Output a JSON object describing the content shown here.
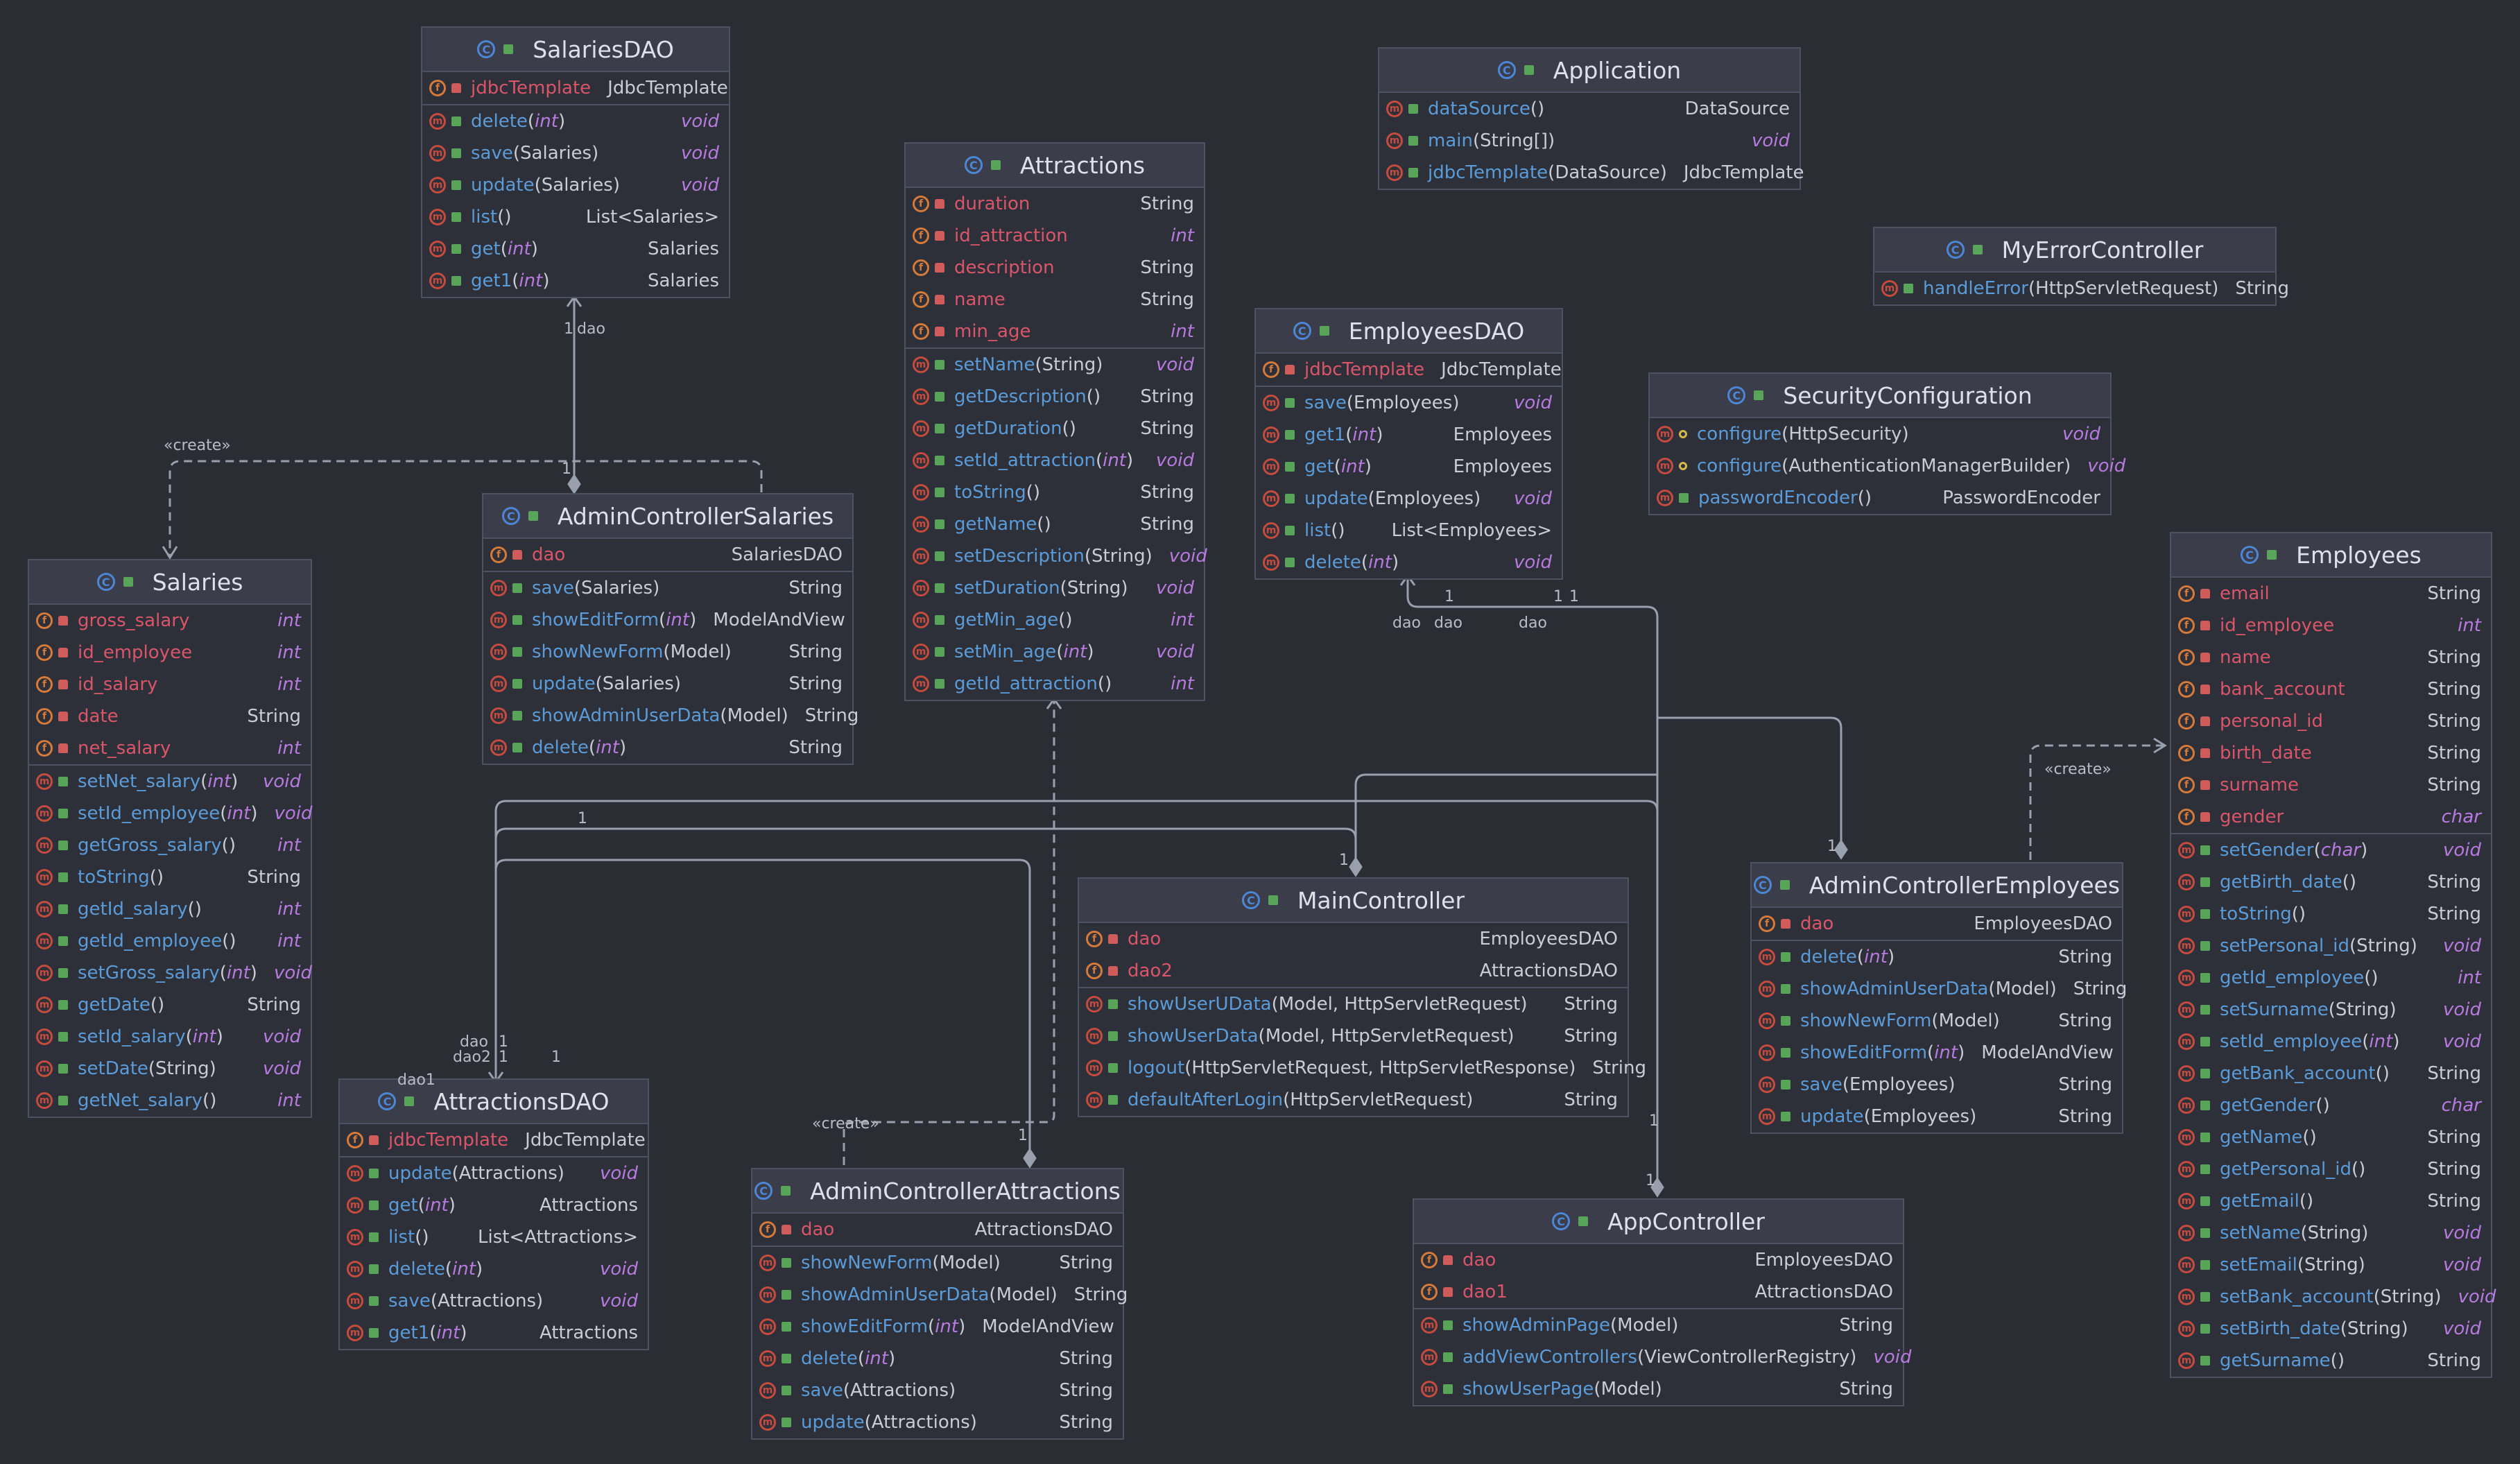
{
  "colors": {
    "background": "#2b2d35",
    "accent_method": "#5a9bd8",
    "field_name": "#d9556a",
    "italic_type": "#b77be0",
    "connector": "#9a9fae"
  },
  "classes": [
    {
      "name": "SalariesDAO",
      "fields": [
        {
          "name": "jdbcTemplate",
          "type": "JdbcTemplate",
          "vis": "private"
        }
      ],
      "methods": [
        {
          "name": "delete",
          "params": "int",
          "ret": "void",
          "vis": "public"
        },
        {
          "name": "save",
          "params": "Salaries",
          "ret": "void",
          "vis": "public"
        },
        {
          "name": "update",
          "params": "Salaries",
          "ret": "void",
          "vis": "public"
        },
        {
          "name": "list",
          "params": "",
          "ret": "List<Salaries>",
          "vis": "public"
        },
        {
          "name": "get",
          "params": "int",
          "ret": "Salaries",
          "vis": "public"
        },
        {
          "name": "get1",
          "params": "int",
          "ret": "Salaries",
          "vis": "public"
        }
      ]
    },
    {
      "name": "Application",
      "fields": [],
      "methods": [
        {
          "name": "dataSource",
          "params": "",
          "ret": "DataSource",
          "vis": "public"
        },
        {
          "name": "main",
          "params": "String[]",
          "ret": "void",
          "vis": "public"
        },
        {
          "name": "jdbcTemplate",
          "params": "DataSource",
          "ret": "JdbcTemplate",
          "vis": "public"
        }
      ]
    },
    {
      "name": "Attractions",
      "fields": [
        {
          "name": "duration",
          "type": "String",
          "vis": "private"
        },
        {
          "name": "id_attraction",
          "type": "int",
          "vis": "private"
        },
        {
          "name": "description",
          "type": "String",
          "vis": "private"
        },
        {
          "name": "name",
          "type": "String",
          "vis": "private"
        },
        {
          "name": "min_age",
          "type": "int",
          "vis": "private"
        }
      ],
      "methods": [
        {
          "name": "setName",
          "params": "String",
          "ret": "void",
          "vis": "public"
        },
        {
          "name": "getDescription",
          "params": "",
          "ret": "String",
          "vis": "public"
        },
        {
          "name": "getDuration",
          "params": "",
          "ret": "String",
          "vis": "public"
        },
        {
          "name": "setId_attraction",
          "params": "int",
          "ret": "void",
          "vis": "public"
        },
        {
          "name": "toString",
          "params": "",
          "ret": "String",
          "vis": "public"
        },
        {
          "name": "getName",
          "params": "",
          "ret": "String",
          "vis": "public"
        },
        {
          "name": "setDescription",
          "params": "String",
          "ret": "void",
          "vis": "public"
        },
        {
          "name": "setDuration",
          "params": "String",
          "ret": "void",
          "vis": "public"
        },
        {
          "name": "getMin_age",
          "params": "",
          "ret": "int",
          "vis": "public"
        },
        {
          "name": "setMin_age",
          "params": "int",
          "ret": "void",
          "vis": "public"
        },
        {
          "name": "getId_attraction",
          "params": "",
          "ret": "int",
          "vis": "public"
        }
      ]
    },
    {
      "name": "MyErrorController",
      "fields": [],
      "methods": [
        {
          "name": "handleError",
          "params": "HttpServletRequest",
          "ret": "String",
          "vis": "public"
        }
      ]
    },
    {
      "name": "EmployeesDAO",
      "fields": [
        {
          "name": "jdbcTemplate",
          "type": "JdbcTemplate",
          "vis": "private"
        }
      ],
      "methods": [
        {
          "name": "save",
          "params": "Employees",
          "ret": "void",
          "vis": "public"
        },
        {
          "name": "get1",
          "params": "int",
          "ret": "Employees",
          "vis": "public"
        },
        {
          "name": "get",
          "params": "int",
          "ret": "Employees",
          "vis": "public"
        },
        {
          "name": "update",
          "params": "Employees",
          "ret": "void",
          "vis": "public"
        },
        {
          "name": "list",
          "params": "",
          "ret": "List<Employees>",
          "vis": "public"
        },
        {
          "name": "delete",
          "params": "int",
          "ret": "void",
          "vis": "public"
        }
      ]
    },
    {
      "name": "SecurityConfiguration",
      "fields": [],
      "methods": [
        {
          "name": "configure",
          "params": "HttpSecurity",
          "ret": "void",
          "vis": "protected"
        },
        {
          "name": "configure",
          "params": "AuthenticationManagerBuilder",
          "ret": "void",
          "vis": "protected"
        },
        {
          "name": "passwordEncoder",
          "params": "",
          "ret": "PasswordEncoder",
          "vis": "public"
        }
      ]
    },
    {
      "name": "AdminControllerSalaries",
      "fields": [
        {
          "name": "dao",
          "type": "SalariesDAO",
          "vis": "private"
        }
      ],
      "methods": [
        {
          "name": "save",
          "params": "Salaries",
          "ret": "String",
          "vis": "public"
        },
        {
          "name": "showEditForm",
          "params": "int",
          "ret": "ModelAndView",
          "vis": "public"
        },
        {
          "name": "showNewForm",
          "params": "Model",
          "ret": "String",
          "vis": "public"
        },
        {
          "name": "update",
          "params": "Salaries",
          "ret": "String",
          "vis": "public"
        },
        {
          "name": "showAdminUserData",
          "params": "Model",
          "ret": "String",
          "vis": "public"
        },
        {
          "name": "delete",
          "params": "int",
          "ret": "String",
          "vis": "public"
        }
      ]
    },
    {
      "name": "Salaries",
      "fields": [
        {
          "name": "gross_salary",
          "type": "int",
          "vis": "private"
        },
        {
          "name": "id_employee",
          "type": "int",
          "vis": "private"
        },
        {
          "name": "id_salary",
          "type": "int",
          "vis": "private"
        },
        {
          "name": "date",
          "type": "String",
          "vis": "private"
        },
        {
          "name": "net_salary",
          "type": "int",
          "vis": "private"
        }
      ],
      "methods": [
        {
          "name": "setNet_salary",
          "params": "int",
          "ret": "void",
          "vis": "public"
        },
        {
          "name": "setId_employee",
          "params": "int",
          "ret": "void",
          "vis": "public"
        },
        {
          "name": "getGross_salary",
          "params": "",
          "ret": "int",
          "vis": "public"
        },
        {
          "name": "toString",
          "params": "",
          "ret": "String",
          "vis": "public"
        },
        {
          "name": "getId_salary",
          "params": "",
          "ret": "int",
          "vis": "public"
        },
        {
          "name": "getId_employee",
          "params": "",
          "ret": "int",
          "vis": "public"
        },
        {
          "name": "setGross_salary",
          "params": "int",
          "ret": "void",
          "vis": "public"
        },
        {
          "name": "getDate",
          "params": "",
          "ret": "String",
          "vis": "public"
        },
        {
          "name": "setId_salary",
          "params": "int",
          "ret": "void",
          "vis": "public"
        },
        {
          "name": "setDate",
          "params": "String",
          "ret": "void",
          "vis": "public"
        },
        {
          "name": "getNet_salary",
          "params": "",
          "ret": "int",
          "vis": "public"
        }
      ]
    },
    {
      "name": "Employees",
      "fields": [
        {
          "name": "email",
          "type": "String",
          "vis": "private"
        },
        {
          "name": "id_employee",
          "type": "int",
          "vis": "private"
        },
        {
          "name": "name",
          "type": "String",
          "vis": "private"
        },
        {
          "name": "bank_account",
          "type": "String",
          "vis": "private"
        },
        {
          "name": "personal_id",
          "type": "String",
          "vis": "private"
        },
        {
          "name": "birth_date",
          "type": "String",
          "vis": "private"
        },
        {
          "name": "surname",
          "type": "String",
          "vis": "private"
        },
        {
          "name": "gender",
          "type": "char",
          "vis": "private"
        }
      ],
      "methods": [
        {
          "name": "setGender",
          "params": "char",
          "ret": "void",
          "vis": "public"
        },
        {
          "name": "getBirth_date",
          "params": "",
          "ret": "String",
          "vis": "public"
        },
        {
          "name": "toString",
          "params": "",
          "ret": "String",
          "vis": "public"
        },
        {
          "name": "setPersonal_id",
          "params": "String",
          "ret": "void",
          "vis": "public"
        },
        {
          "name": "getId_employee",
          "params": "",
          "ret": "int",
          "vis": "public"
        },
        {
          "name": "setSurname",
          "params": "String",
          "ret": "void",
          "vis": "public"
        },
        {
          "name": "setId_employee",
          "params": "int",
          "ret": "void",
          "vis": "public"
        },
        {
          "name": "getBank_account",
          "params": "",
          "ret": "String",
          "vis": "public"
        },
        {
          "name": "getGender",
          "params": "",
          "ret": "char",
          "vis": "public"
        },
        {
          "name": "getName",
          "params": "",
          "ret": "String",
          "vis": "public"
        },
        {
          "name": "getPersonal_id",
          "params": "",
          "ret": "String",
          "vis": "public"
        },
        {
          "name": "getEmail",
          "params": "",
          "ret": "String",
          "vis": "public"
        },
        {
          "name": "setName",
          "params": "String",
          "ret": "void",
          "vis": "public"
        },
        {
          "name": "setEmail",
          "params": "String",
          "ret": "void",
          "vis": "public"
        },
        {
          "name": "setBank_account",
          "params": "String",
          "ret": "void",
          "vis": "public"
        },
        {
          "name": "setBirth_date",
          "params": "String",
          "ret": "void",
          "vis": "public"
        },
        {
          "name": "getSurname",
          "params": "",
          "ret": "String",
          "vis": "public"
        }
      ]
    },
    {
      "name": "MainController",
      "fields": [
        {
          "name": "dao",
          "type": "EmployeesDAO",
          "vis": "private"
        },
        {
          "name": "dao2",
          "type": "AttractionsDAO",
          "vis": "private"
        }
      ],
      "methods": [
        {
          "name": "showUserUData",
          "params": "Model, HttpServletRequest",
          "ret": "String",
          "vis": "public"
        },
        {
          "name": "showUserData",
          "params": "Model, HttpServletRequest",
          "ret": "String",
          "vis": "public"
        },
        {
          "name": "logout",
          "params": "HttpServletRequest, HttpServletResponse",
          "ret": "String",
          "vis": "public"
        },
        {
          "name": "defaultAfterLogin",
          "params": "HttpServletRequest",
          "ret": "String",
          "vis": "public"
        }
      ]
    },
    {
      "name": "AdminControllerEmployees",
      "fields": [
        {
          "name": "dao",
          "type": "EmployeesDAO",
          "vis": "private"
        }
      ],
      "methods": [
        {
          "name": "delete",
          "params": "int",
          "ret": "String",
          "vis": "public"
        },
        {
          "name": "showAdminUserData",
          "params": "Model",
          "ret": "String",
          "vis": "public"
        },
        {
          "name": "showNewForm",
          "params": "Model",
          "ret": "String",
          "vis": "public"
        },
        {
          "name": "showEditForm",
          "params": "int",
          "ret": "ModelAndView",
          "vis": "public"
        },
        {
          "name": "save",
          "params": "Employees",
          "ret": "String",
          "vis": "public"
        },
        {
          "name": "update",
          "params": "Employees",
          "ret": "String",
          "vis": "public"
        }
      ]
    },
    {
      "name": "AttractionsDAO",
      "fields": [
        {
          "name": "jdbcTemplate",
          "type": "JdbcTemplate",
          "vis": "private"
        }
      ],
      "methods": [
        {
          "name": "update",
          "params": "Attractions",
          "ret": "void",
          "vis": "public"
        },
        {
          "name": "get",
          "params": "int",
          "ret": "Attractions",
          "vis": "public"
        },
        {
          "name": "list",
          "params": "",
          "ret": "List<Attractions>",
          "vis": "public"
        },
        {
          "name": "delete",
          "params": "int",
          "ret": "void",
          "vis": "public"
        },
        {
          "name": "save",
          "params": "Attractions",
          "ret": "void",
          "vis": "public"
        },
        {
          "name": "get1",
          "params": "int",
          "ret": "Attractions",
          "vis": "public"
        }
      ]
    },
    {
      "name": "AdminControllerAttractions",
      "fields": [
        {
          "name": "dao",
          "type": "AttractionsDAO",
          "vis": "private"
        }
      ],
      "methods": [
        {
          "name": "showNewForm",
          "params": "Model",
          "ret": "String",
          "vis": "public"
        },
        {
          "name": "showAdminUserData",
          "params": "Model",
          "ret": "String",
          "vis": "public"
        },
        {
          "name": "showEditForm",
          "params": "int",
          "ret": "ModelAndView",
          "vis": "public"
        },
        {
          "name": "delete",
          "params": "int",
          "ret": "String",
          "vis": "public"
        },
        {
          "name": "save",
          "params": "Attractions",
          "ret": "String",
          "vis": "public"
        },
        {
          "name": "update",
          "params": "Attractions",
          "ret": "String",
          "vis": "public"
        }
      ]
    },
    {
      "name": "AppController",
      "fields": [
        {
          "name": "dao",
          "type": "EmployeesDAO",
          "vis": "private"
        },
        {
          "name": "dao1",
          "type": "AttractionsDAO",
          "vis": "private"
        }
      ],
      "methods": [
        {
          "name": "showAdminPage",
          "params": "Model",
          "ret": "String",
          "vis": "public"
        },
        {
          "name": "addViewControllers",
          "params": "ViewControllerRegistry",
          "ret": "void",
          "vis": "public"
        },
        {
          "name": "showUserPage",
          "params": "Model",
          "ret": "String",
          "vis": "public"
        }
      ]
    }
  ],
  "edge_labels": [
    "1",
    "dao",
    "«create»",
    "1",
    "1",
    "1",
    "dao",
    "dao",
    "dao",
    "1",
    "1",
    "«create»",
    "dao",
    "1",
    "dao2",
    "1",
    "dao1",
    "1",
    "«create»",
    "1",
    "1",
    "1",
    "1",
    "1"
  ]
}
